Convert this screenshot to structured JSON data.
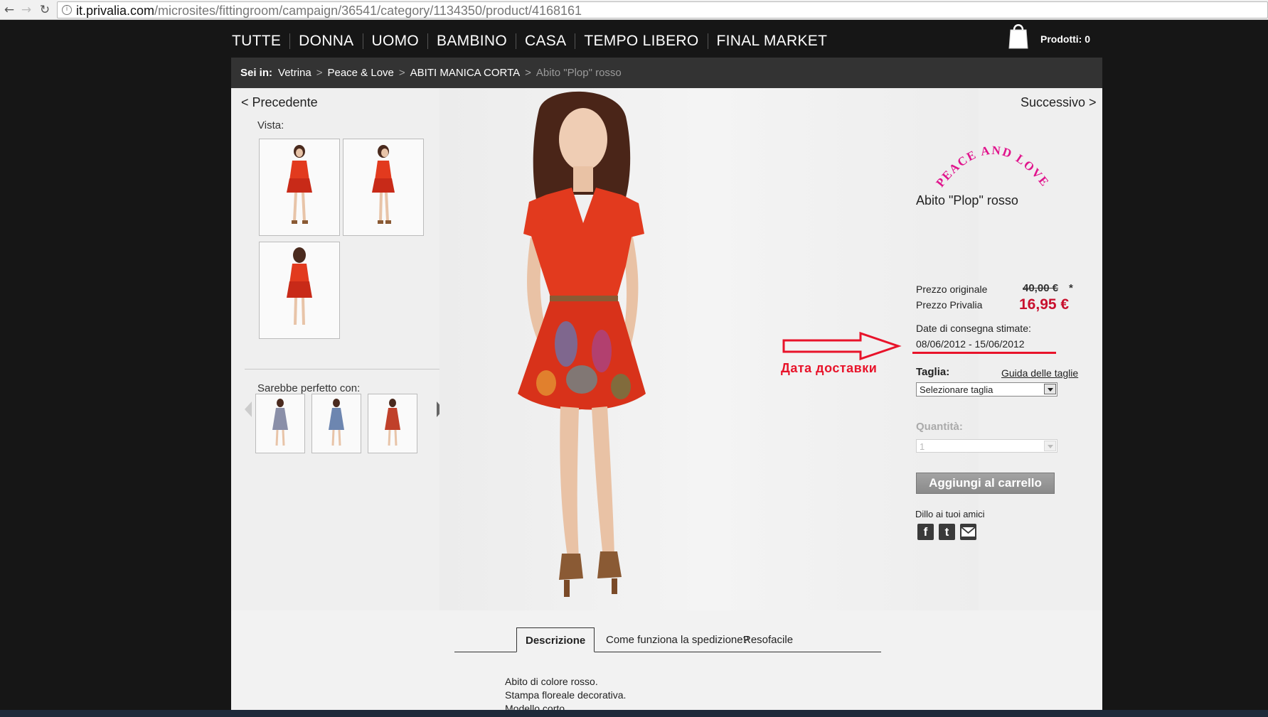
{
  "browser": {
    "url_host": "it.privalia.com",
    "url_path": "/microsites/fittingroom/campaign/36541/category/1134350/product/4168161"
  },
  "nav": {
    "items": [
      "TUTTE",
      "DONNA",
      "UOMO",
      "BAMBINO",
      "CASA",
      "TEMPO LIBERO",
      "FINAL MARKET"
    ],
    "cart_label": "Prodotti: 0"
  },
  "breadcrumb": {
    "label": "Sei in:",
    "items": [
      "Vetrina",
      "Peace & Love",
      "ABITI MANICA CORTA"
    ],
    "current": "Abito \"Plop\" rosso",
    "separator": ">"
  },
  "gallery": {
    "prev_label": "< Precedente",
    "next_label": "Successivo >",
    "vista_label": "Vista:",
    "perfect_with_label": "Sarebbe perfetto con:"
  },
  "product": {
    "brand_logo_text": "PEACE AND LOVE",
    "title": "Abito \"Plop\" rosso",
    "original_price_label": "Prezzo originale",
    "original_price": "40,00 €",
    "original_price_mark": "*",
    "privalia_price_label": "Prezzo Privalia",
    "privalia_price": "16,95 €",
    "delivery_label": "Date di consegna stimate:",
    "delivery_dates": "08/06/2012 - 15/06/2012",
    "annotation": "Дата доставки",
    "size_label": "Taglia:",
    "size_guide_link": "Guida delle taglie",
    "size_select_value": "Selezionare taglia",
    "quantity_label": "Quantità:",
    "quantity_value": "1",
    "add_to_cart": "Aggiungi al carrello",
    "share_label": "Dillo ai tuoi amici"
  },
  "tabs": {
    "items": [
      "Descrizione",
      "Come funziona la spedizione?",
      "Resofacile"
    ],
    "active": "Descrizione"
  },
  "description": {
    "lines": [
      "Abito di colore rosso.",
      "Stampa floreale decorativa.",
      "Modello corto."
    ]
  },
  "colors": {
    "price_red": "#c8102e",
    "annotation_red": "#e8132a",
    "brand_pink": "#e0148c",
    "dress_red": "#e23a1e"
  }
}
